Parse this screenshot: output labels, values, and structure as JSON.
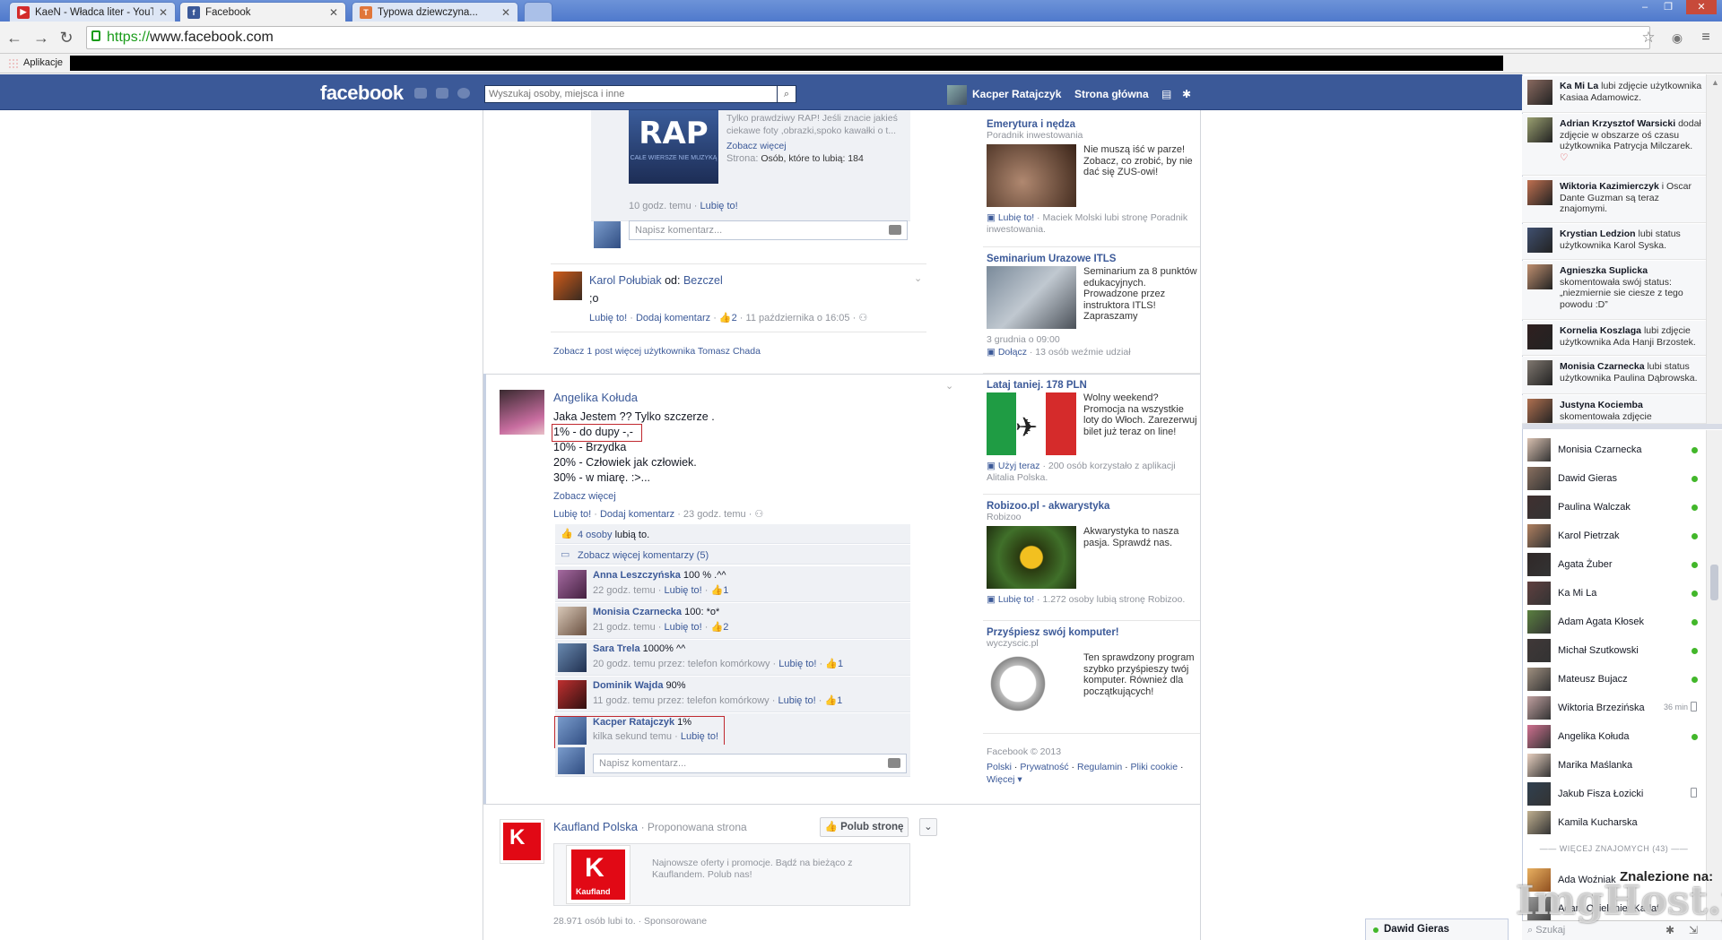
{
  "browser": {
    "tabs": [
      {
        "title": "KaeN - Władca liter - YouTub",
        "fav_color": "#d32b2b",
        "fav": "▶"
      },
      {
        "title": "Facebook",
        "fav_color": "#3b5998",
        "fav": "f"
      },
      {
        "title": "Typowa dziewczyna...",
        "fav_color": "#e0763a",
        "fav": "T"
      }
    ],
    "url_scheme": "https://",
    "url_rest": "www.facebook.com",
    "bookmarks_apps": "Aplikacje",
    "win_controls": [
      "–",
      "❐",
      "✕"
    ]
  },
  "fb": {
    "logo": "facebook",
    "search_placeholder": "Wyszukaj osoby, miejsca i inne",
    "me_name": "Kacper Ratajczyk",
    "home": "Strona główna"
  },
  "feed": {
    "shared_post": {
      "desc": "Tylko prawdziwy RAP! Jeśli znacie jakieś ciekawe foty ,obrazki,spoko kawałki o t...",
      "see_more": "Zobacz więcej",
      "page_label": "Strona:",
      "page_likes": "Osób, które to lubią: 184",
      "time": "10 godz. temu",
      "like": "Lubię to!",
      "img_text": "RAP",
      "img_sub": "CAŁE WIERSZE NIE MUZYKĄ",
      "comment_placeholder": "Napisz komentarz..."
    },
    "karol": {
      "name": "Karol Połubiak",
      "from": "od:",
      "source": "Bezczel",
      "text": ";o",
      "like": "Lubię to!",
      "add_comment": "Dodaj komentarz",
      "likes": "2",
      "date": "11 października o 16:05",
      "more": "Zobacz 1 post więcej użytkownika Tomasz Chada"
    },
    "angelika": {
      "name": "Angelika Kołuda",
      "lines": [
        "Jaka Jestem ?? Tylko szczerze .",
        "1% - do dupy -,-",
        "10% - Brzydka",
        "20% - Człowiek jak człowiek.",
        "30% - w miarę. :>..."
      ],
      "see_more": "Zobacz więcej",
      "like": "Lubię to!",
      "add_comment": "Dodaj komentarz",
      "time": "23 godz. temu",
      "likes_count": "4 osoby",
      "likes_suffix": "lubią to.",
      "more_comments": "Zobacz więcej komentarzy (5)",
      "comments": [
        {
          "name": "Anna Leszczyńska",
          "text": "100 % .^^",
          "time": "22 godz. temu",
          "via": "",
          "likes": "1"
        },
        {
          "name": "Monisia Czarnecka",
          "text": "100: *o*",
          "time": "21 godz. temu",
          "via": "",
          "likes": "2"
        },
        {
          "name": "Sara Trela",
          "text": "1000% ^^",
          "time": "20 godz. temu",
          "via": "przez: telefon komórkowy",
          "likes": "1"
        },
        {
          "name": "Dominik Wajda",
          "text": "90%",
          "time": "11 godz. temu",
          "via": "przez: telefon komórkowy",
          "likes": "1"
        },
        {
          "name": "Kacper Ratajczyk",
          "text": "1%",
          "time": "kilka sekund temu",
          "via": "",
          "likes": ""
        }
      ],
      "comment_like": "Lubię to!",
      "comment_placeholder": "Napisz komentarz..."
    },
    "kaufland": {
      "name": "Kaufland Polska",
      "suggested": "Proponowana strona",
      "like_btn": "Polub stronę",
      "logo_text": "Kaufland",
      "desc": "Najnowsze oferty i promocje. Bądź na bieżąco z Kauflandem. Polub nas!",
      "likes": "28.971 osób lubi to.",
      "sponsored": "Sponsorowane"
    }
  },
  "ads": [
    {
      "title": "Emerytura i nędza",
      "sub": "Poradnik inwestowania",
      "desc": "Nie muszą iść w parze! Zobacz, co zrobić, by nie dać się ZUS-owi!",
      "action": "Lubię to!",
      "footer": "Maciek Molski lubi stronę Poradnik inwestowania."
    },
    {
      "title": "Seminarium Urazowe ITLS",
      "sub": "",
      "desc": "Seminarium za 8 punktów edukacyjnych. Prowadzone przez instruktora ITLS! Zapraszamy",
      "date": "3 grudnia o 09:00",
      "action": "Dołącz",
      "footer": "13 osób weźmie udział"
    },
    {
      "title": "Lataj taniej. 178 PLN",
      "sub": "",
      "desc": "Wolny weekend? Promocja na wszystkie loty do Włoch. Zarezerwuj bilet już teraz on line!",
      "action": "Użyj teraz",
      "footer": "200 osób korzystało z aplikacji Alitalia Polska."
    },
    {
      "title": "Robizoo.pl - akwarystyka",
      "sub": "Robizoo",
      "desc": "Akwarystyka to nasza pasja. Sprawdź nas.",
      "action": "Lubię to!",
      "footer": "1.272 osoby lubią stronę Robizoo."
    },
    {
      "title": "Przyśpiesz swój komputer!",
      "sub": "wyczyscic.pl",
      "desc": "Ten sprawdzony program szybko przyśpieszy twój komputer. Również dla początkujących!",
      "action": "",
      "footer": ""
    }
  ],
  "footer": {
    "copyright": "Facebook © 2013",
    "links": [
      "Polski",
      "Prywatność",
      "Regulamin",
      "Pliki cookie"
    ],
    "more": "Więcej"
  },
  "ticker": [
    {
      "name": "Ka Mi La",
      "text": "lubi zdjęcie użytkownika Kasiaa Adamowicz."
    },
    {
      "name": "Adrian Krzysztof Warsicki",
      "text": "dodał zdjęcie w obszarze oś czasu użytkownika Patrycja Milczarek."
    },
    {
      "name": "Wiktoria Kazimierczyk",
      "text": "i Oscar Dante Guzman są teraz znajomymi."
    },
    {
      "name": "Krystian Ledzion",
      "text": "lubi status użytkownika Karol Syska."
    },
    {
      "name": "Agnieszka Suplicka",
      "text": "skomentowała swój status: „niezmiernie sie ciesze z tego powodu :D”"
    },
    {
      "name": "Kornelia Koszlaga",
      "text": "lubi zdjęcie użytkownika Ada Hanji Brzostek."
    },
    {
      "name": "Monisia Czarnecka",
      "text": "lubi status użytkownika Paulina Dąbrowska."
    },
    {
      "name": "Justyna Kociemba",
      "text": "skomentowała zdjęcie"
    }
  ],
  "chat": {
    "online": [
      {
        "name": "Monisia Czarnecka",
        "status": "dot"
      },
      {
        "name": "Dawid Gieras",
        "status": "dot"
      },
      {
        "name": "Paulina Walczak",
        "status": "dot"
      },
      {
        "name": "Karol Pietrzak",
        "status": "dot"
      },
      {
        "name": "Agata Żuber",
        "status": "dot"
      },
      {
        "name": "Ka Mi La",
        "status": "dot"
      },
      {
        "name": "Adam Agata Kłosek",
        "status": "dot"
      },
      {
        "name": "Michał Szutkowski",
        "status": "dot"
      },
      {
        "name": "Mateusz Bujacz",
        "status": "dot"
      },
      {
        "name": "Wiktoria Brzezińska",
        "status": "mob",
        "time": "36 min"
      },
      {
        "name": "Angelika Kołuda",
        "status": "dot"
      },
      {
        "name": "Marika Maślanka",
        "status": ""
      },
      {
        "name": "Jakub Fisza Łozicki",
        "status": "mob"
      },
      {
        "name": "Kamila Kucharska",
        "status": ""
      }
    ],
    "more_friends": "WIĘCEJ ZNAJOMYCH (43)",
    "more_list": [
      "Ada Woźniak",
      "Adam Osielenier Kadafi"
    ],
    "search": "Szukaj",
    "open_chat": "Dawid Gieras"
  },
  "watermark": {
    "line1": "Znalezione na:",
    "line2": "ImgHost.pl"
  }
}
